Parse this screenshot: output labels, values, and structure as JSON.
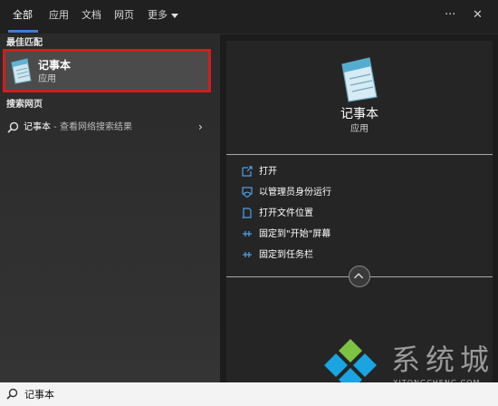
{
  "tabs": [
    {
      "label": "全部"
    },
    {
      "label": "应用"
    },
    {
      "label": "文档"
    },
    {
      "label": "网页"
    },
    {
      "label": "更多"
    }
  ],
  "top_icons": {
    "more_options": "···",
    "close": "✕"
  },
  "left": {
    "best_match_label": "最佳匹配",
    "best_match": {
      "title": "记事本",
      "subtitle": "应用"
    },
    "web_search_label": "搜索网页",
    "web_result": {
      "query": "记事本",
      "suffix": " - 查看网络搜索结果"
    }
  },
  "detail": {
    "title": "记事本",
    "subtitle": "应用",
    "actions": [
      {
        "label": "打开",
        "icon": "open-icon"
      },
      {
        "label": "以管理员身份运行",
        "icon": "shield-run-icon"
      },
      {
        "label": "打开文件位置",
        "icon": "file-location-icon"
      },
      {
        "label": "固定到\"开始\"屏幕",
        "icon": "pin-icon"
      },
      {
        "label": "固定到任务栏",
        "icon": "pin-icon"
      }
    ]
  },
  "watermark": {
    "text": "系统城",
    "url": "XITONGCHENG.COM"
  },
  "search": {
    "value": "记事本"
  },
  "colors": {
    "accent": "#3e7ed6",
    "highlight_border": "#d21d1d",
    "panel": "#252525"
  }
}
